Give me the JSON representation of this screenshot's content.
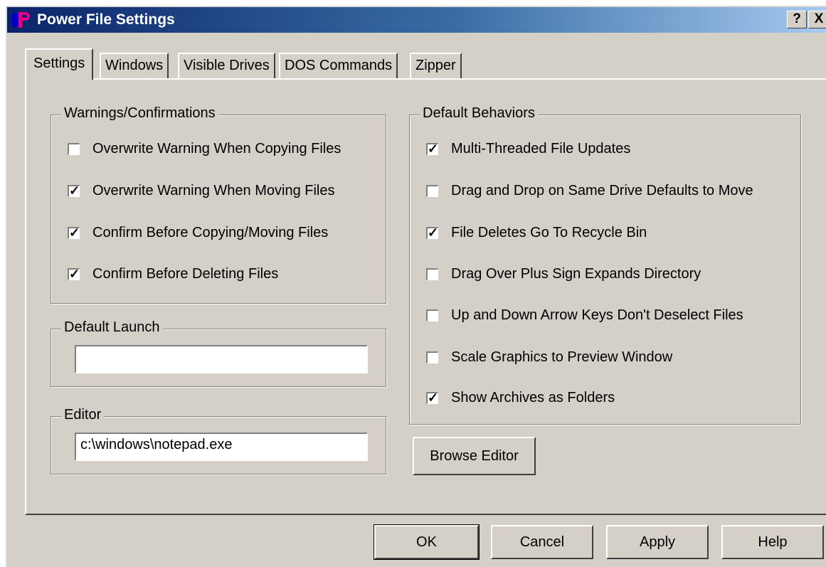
{
  "window": {
    "title": "Power File Settings",
    "help_label": "?",
    "close_label": "X"
  },
  "tabs": [
    {
      "label": "Settings"
    },
    {
      "label": "Windows"
    },
    {
      "label": "Visible Drives"
    },
    {
      "label": "DOS Commands"
    },
    {
      "label": "Zipper"
    }
  ],
  "warnings": {
    "label": "Warnings/Confirmations",
    "items": [
      {
        "label": "Overwrite Warning When Copying Files",
        "checked": false
      },
      {
        "label": "Overwrite Warning When Moving Files",
        "checked": true
      },
      {
        "label": "Confirm Before Copying/Moving Files",
        "checked": true
      },
      {
        "label": "Confirm Before Deleting Files",
        "checked": true
      }
    ]
  },
  "default_launch": {
    "label": "Default Launch",
    "value": ""
  },
  "editor": {
    "label": "Editor",
    "value": "c:\\windows\\notepad.exe"
  },
  "behaviors": {
    "label": "Default Behaviors",
    "items": [
      {
        "label": "Multi-Threaded File Updates",
        "checked": true
      },
      {
        "label": "Drag and Drop on Same Drive Defaults to Move",
        "checked": false
      },
      {
        "label": "File Deletes Go To Recycle Bin",
        "checked": true
      },
      {
        "label": "Drag Over Plus Sign Expands Directory",
        "checked": false
      },
      {
        "label": "Up and Down Arrow Keys Don't Deselect Files",
        "checked": false
      },
      {
        "label": "Scale Graphics to Preview Window",
        "checked": false
      },
      {
        "label": "Show Archives as Folders",
        "checked": true
      }
    ]
  },
  "buttons": {
    "browse_editor": "Browse Editor",
    "ok": "OK",
    "cancel": "Cancel",
    "apply": "Apply",
    "help": "Help"
  },
  "colors": {
    "face": "#d4d0c8",
    "title_start": "#0a246a",
    "title_end": "#a6caf0",
    "icon_magenta": "#e00090"
  }
}
